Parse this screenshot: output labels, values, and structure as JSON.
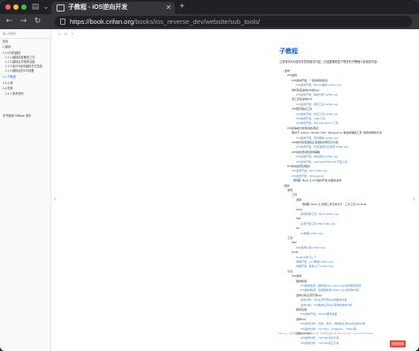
{
  "browser": {
    "tab_title": "子教程 - iOS逆向开发",
    "url_host": "https://book.crifan.org",
    "url_path": "/books/ios_reverse_dev/website/sub_tools/",
    "icons": {
      "sidebar_toggle": "sidebar-icon",
      "tab_overview": "tab-overview-icon",
      "back": "back-arrow-icon",
      "forward": "forward-arrow-icon",
      "reload": "reload-icon",
      "lock": "lock-icon"
    }
  },
  "sidebar": {
    "search_placeholder": "输入并搜索",
    "items": [
      {
        "label": "前言",
        "active": false
      },
      {
        "label": "1 越狱",
        "active": false
      },
      {
        "label": "1.1 iOS的越狱",
        "active": false
      },
      {
        "label": "1.1.1 越狱前准备的工作",
        "active": false
      },
      {
        "label": "1.1.2 越狱后可用的功能",
        "active": false
      },
      {
        "label": "1.1.3 各iOS版本越狱方式总结",
        "active": false
      },
      {
        "label": "1.1.4 越狱后的iOS设备",
        "active": false
      },
      {
        "label": "1.2 子教程",
        "active": true
      },
      {
        "label": "1.3 心得",
        "active": false
      },
      {
        "label": "1.4 附录",
        "active": false
      },
      {
        "label": "1.4.1 参考资料",
        "active": false
      },
      {
        "label": "本书使用 GitBook 发布",
        "active": false
      }
    ]
  },
  "content": {
    "toolbar": [
      "A",
      "☰",
      "↗"
    ],
    "title": "子教程",
    "intro": "之前有关iOS逆向开发的相关内容，已经整理成如下很多的子教程以及相关内容：",
    "footer": "crifan.org，使用知识署名4.0国际 (CC BY 4.0)协议发布 all right reserved，powered by Gitbook",
    "footer_right": "该文件修订时间：2022-11-28 11:30:39",
    "top_button": "回到顶部",
    "toc": [
      {
        "depth": 0,
        "text": "• 逆向",
        "link": false
      },
      {
        "depth": 1,
        "text": "iOS逆向",
        "link": false
      },
      {
        "depth": 2,
        "text": "iOS逆向开发：一些通用的知识",
        "link": false
      },
      {
        "depth": 3,
        "text": "iOS逆向开发：iPhone越狱 (crifan.org)",
        "link": true
      },
      {
        "depth": 2,
        "text": "用代码来逆向iOS的App",
        "link": false
      },
      {
        "depth": 3,
        "text": "iOS逆向开发：静态分析 (crifan.org)",
        "link": true
      },
      {
        "depth": 2,
        "text": "用工具来逆向iOS",
        "link": false
      },
      {
        "depth": 3,
        "text": "iOS逆向开发：砸壳工具 (crifan.org)",
        "link": true
      },
      {
        "depth": 2,
        "text": "iOS砸壳相关工具",
        "link": false
      },
      {
        "depth": 3,
        "text": "iOS逆向开发：抓包工具 (crifan.org)",
        "link": true
      },
      {
        "depth": 3,
        "text": "iOS逆向开发：Frida工具",
        "link": true
      },
      {
        "depth": 3,
        "text": "iOS逆向开发：IDA (Hex-Rays) 工具",
        "link": true
      },
      {
        "depth": 1,
        "text": "iOS的静态分析和动态调试",
        "link": false
      },
      {
        "depth": 2,
        "text": "相对于 Hopper / Ghidra / lldb / debugserver 等逆向辅助工具, 使用常规的方法",
        "link": false
      },
      {
        "depth": 3,
        "text": "iOS逆向开发：调试器类 (crifan.org)",
        "link": true
      },
      {
        "depth": 2,
        "text": "iOS的代码混淆和反混淆技术研究与分析",
        "link": false
      },
      {
        "depth": 3,
        "text": "iOS逆向开发：代码混淆与反混淆 (crifan.org)",
        "link": true
      },
      {
        "depth": 2,
        "text": "iOS动态调试和逆向辅助",
        "link": false
      },
      {
        "depth": 3,
        "text": "iOS逆向开发：动态调试 (crifan.org)",
        "link": true
      },
      {
        "depth": 3,
        "text": "iOS逆向开发：iOS/macOS/Xcode 开发工具",
        "link": true
      },
      {
        "depth": 1,
        "text": "iOS的动态调试相关",
        "link": false
      },
      {
        "depth": 2,
        "text": "iOS逆向开发：lldb (crifan.org)",
        "link": true
      },
      {
        "depth": 2,
        "text": "iOS逆向开发：debugserver",
        "link": true
      },
      {
        "depth": 2,
        "text": "【整理】Book 之 iOS逆向开发  的相关资料",
        "link": false
      },
      {
        "depth": 0,
        "text": "• 相关",
        "link": false
      },
      {
        "depth": 1,
        "text": "通用",
        "link": false
      },
      {
        "depth": 2,
        "text": "工具",
        "link": false
      },
      {
        "depth": 3,
        "text": "通用",
        "link": false
      },
      {
        "depth": 4,
        "text": "【整理】Book 之 终端工具与命令行 : 三方工具  Terminal",
        "link": false
      },
      {
        "depth": 3,
        "text": "Shell",
        "link": false
      },
      {
        "depth": 4,
        "text": "通用终端工具 : Shell (crifan.org)",
        "link": true
      },
      {
        "depth": 3,
        "text": "IDE",
        "link": false
      },
      {
        "depth": 4,
        "text": "主流开发工具 IDE (crifan.org)",
        "link": true
      },
      {
        "depth": 3,
        "text": "Git",
        "link": false
      },
      {
        "depth": 4,
        "text": "Git教程 (crifan.org)",
        "link": true
      },
      {
        "depth": 1,
        "text": "工具",
        "link": false
      },
      {
        "depth": 2,
        "text": "Mac",
        "link": false
      },
      {
        "depth": 3,
        "text": "Mac使用心得 (crifan.org)",
        "link": true
      },
      {
        "depth": 2,
        "text": "Node",
        "link": false
      },
      {
        "depth": 3,
        "text": "NodeJS学习入门",
        "link": true
      },
      {
        "depth": 3,
        "text": "前端开发 : 入门教程 (crifan.org)",
        "link": true
      },
      {
        "depth": 3,
        "text": "前端开发 : 框架入门 (crifan.org)",
        "link": true
      },
      {
        "depth": 1,
        "text": "平台",
        "link": false
      },
      {
        "depth": 2,
        "text": "iOS逆向",
        "link": false
      },
      {
        "depth": 3,
        "text": "越狱检测",
        "link": false
      },
      {
        "depth": 4,
        "text": "iOS越狱检测：越狱类App (crifan.org) 的功能和使用",
        "link": true
      },
      {
        "depth": 4,
        "text": "iOS越狱检测：反越狱检测 (crifan.org) 的具体方案",
        "link": true
      },
      {
        "depth": 3,
        "text": "逆向分析主流开源App",
        "link": false
      },
      {
        "depth": 4,
        "text": "逆向分析：iOS主流开源App的相关内容",
        "link": true
      },
      {
        "depth": 4,
        "text": "逆向分析：iOS各种主流App具体的逆向分析",
        "link": true
      },
      {
        "depth": 3,
        "text": "越狱设备",
        "link": false
      },
      {
        "depth": 4,
        "text": "iOS逆向开发：iPhone越狱设备",
        "link": true
      },
      {
        "depth": 3,
        "text": "逆向App",
        "link": false
      },
      {
        "depth": 4,
        "text": "iOS逆向分析：抖音、快手、微信等主流App的逆向分析",
        "link": true
      },
      {
        "depth": 4,
        "text": "iOS逆向分析：YouTube、Instagram、Twitter等",
        "link": true
      },
      {
        "depth": 3,
        "text": "逆向YouTube",
        "link": false
      },
      {
        "depth": 4,
        "text": "iOS逆向分析：YouTube协议分析",
        "link": true
      },
      {
        "depth": 4,
        "text": "iOS逆向分析：YouTube接口分析",
        "link": true
      }
    ]
  }
}
